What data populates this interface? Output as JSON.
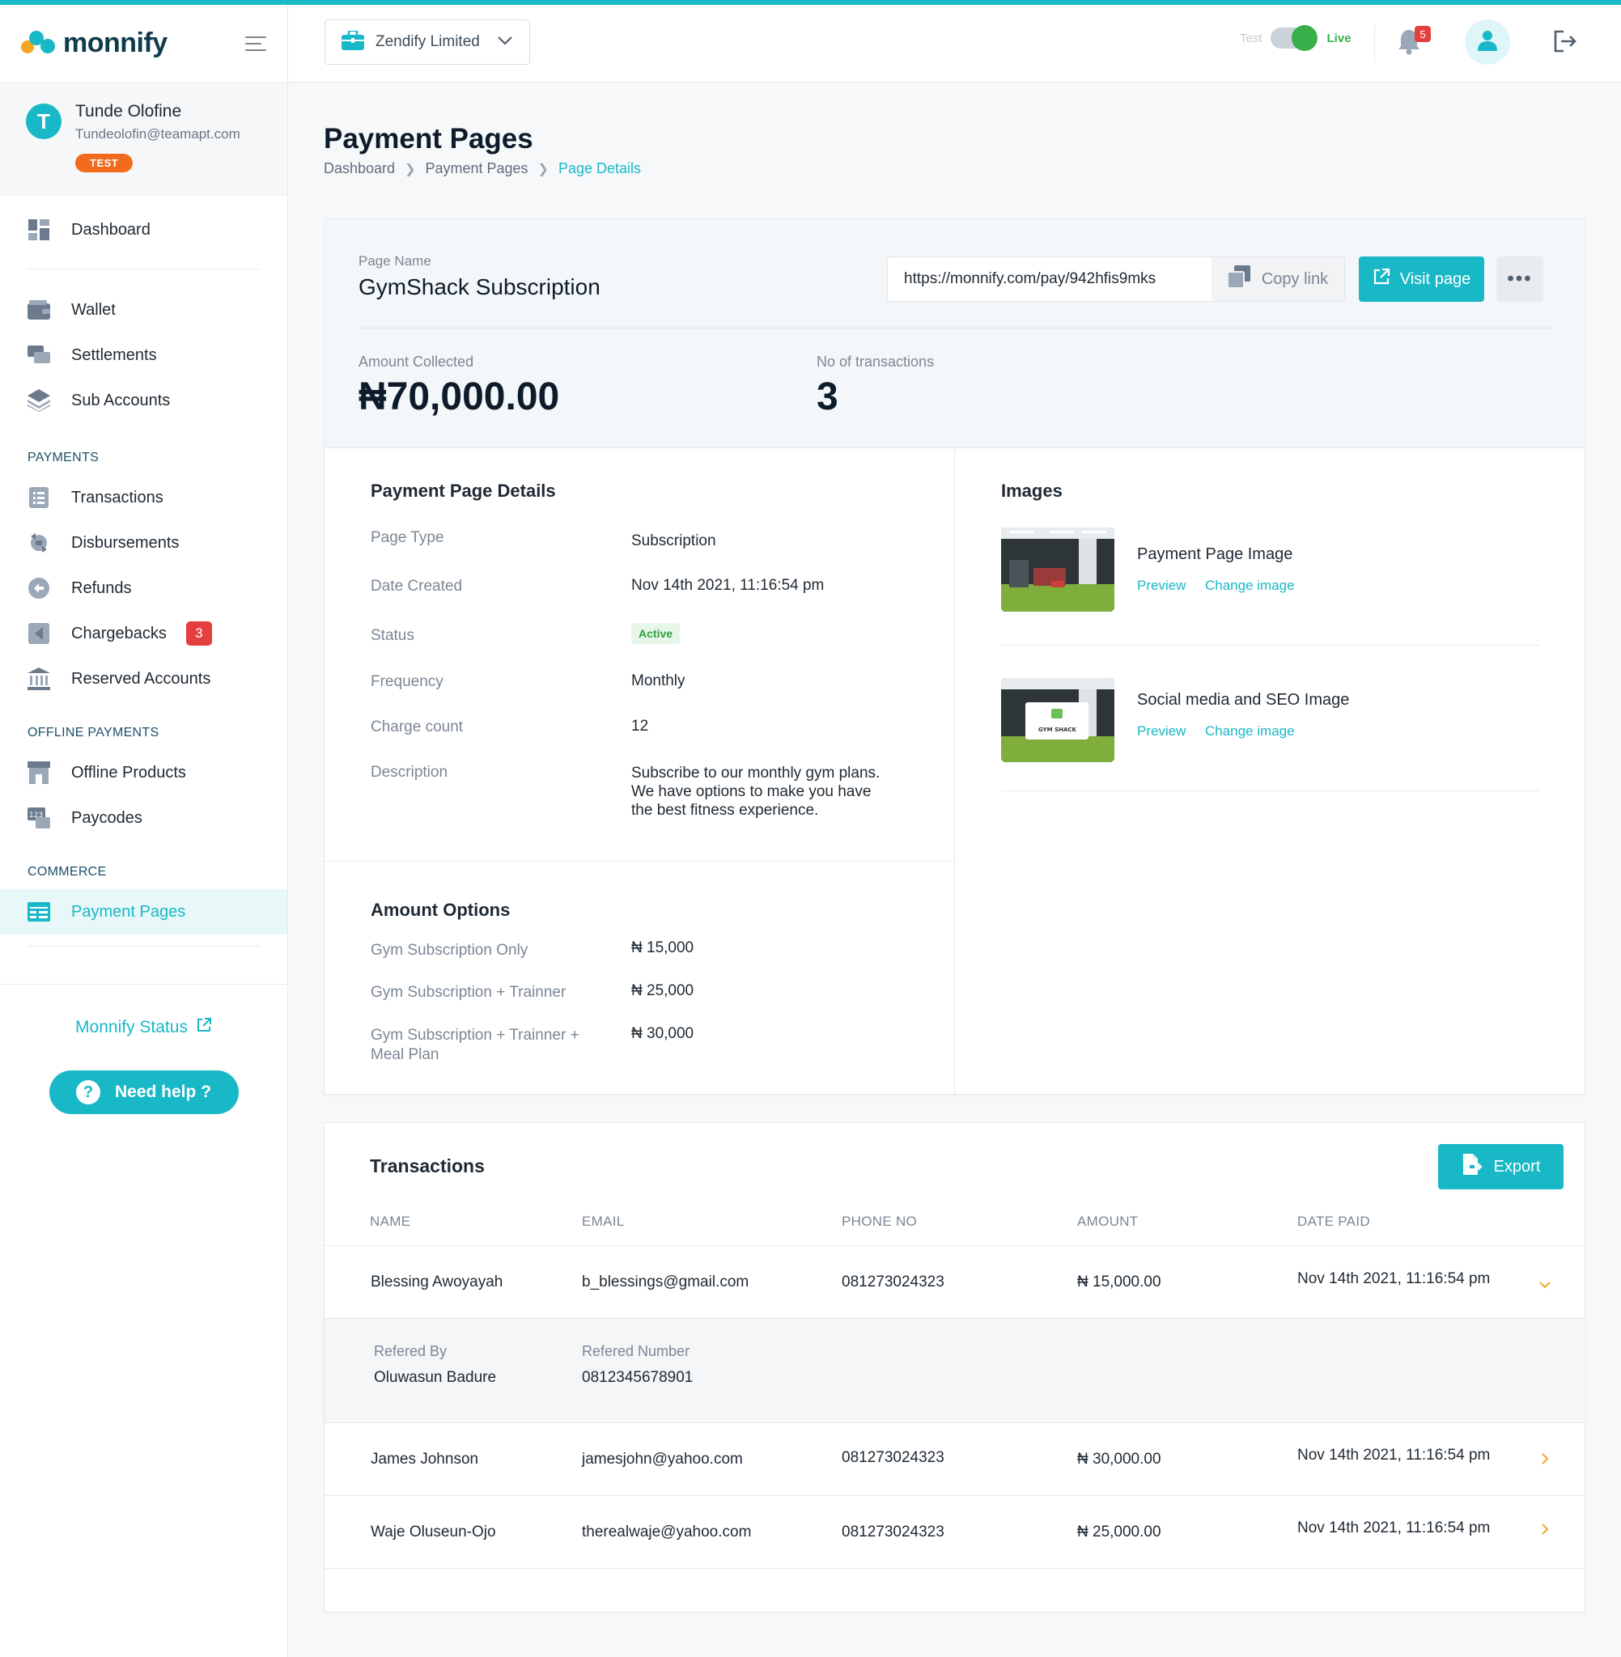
{
  "brand": {
    "name": "monnify",
    "accent": "#19b8c7"
  },
  "user": {
    "initial": "T",
    "name": "Tunde Olofine",
    "email": "Tundeolofin@teamapt.com",
    "env_badge": "TEST"
  },
  "nav": {
    "top": [
      {
        "label": "Dashboard",
        "icon": "dashboard-icon"
      }
    ],
    "main": [
      {
        "label": "Wallet",
        "icon": "wallet-icon"
      },
      {
        "label": "Settlements",
        "icon": "settlements-icon"
      },
      {
        "label": "Sub Accounts",
        "icon": "layers-icon"
      }
    ],
    "payments_heading": "PAYMENTS",
    "payments": [
      {
        "label": "Transactions",
        "icon": "list-icon"
      },
      {
        "label": "Disbursements",
        "icon": "disbursements-icon"
      },
      {
        "label": "Refunds",
        "icon": "refund-icon"
      },
      {
        "label": "Chargebacks",
        "icon": "chargeback-icon",
        "badge": "3"
      },
      {
        "label": "Reserved Accounts",
        "icon": "bank-icon"
      }
    ],
    "offline_heading": "OFFLINE PAYMENTS",
    "offline": [
      {
        "label": "Offline Products",
        "icon": "store-icon"
      },
      {
        "label": "Paycodes",
        "icon": "paycode-icon"
      }
    ],
    "commerce_heading": "COMMERCE",
    "commerce": [
      {
        "label": "Payment Pages",
        "icon": "payment-page-icon",
        "active": true
      }
    ],
    "status_link": "Monnify Status",
    "help_label": "Need help ?"
  },
  "header": {
    "business": "Zendify Limited",
    "mode_test": "Test",
    "mode_live": "Live",
    "notifications_count": "5"
  },
  "page": {
    "title": "Payment Pages",
    "breadcrumb": [
      "Dashboard",
      "Payment Pages",
      "Page Details"
    ]
  },
  "summary": {
    "page_name_label": "Page Name",
    "page_name": "GymShack Subscription",
    "url": "https://monnify.com/pay/942hfis9mks",
    "copy_label": "Copy link",
    "visit_label": "Visit page",
    "amount_label": "Amount Collected",
    "amount": "₦70,000.00",
    "tx_count_label": "No of transactions",
    "tx_count": "3"
  },
  "details": {
    "heading": "Payment Page Details",
    "page_type_label": "Page Type",
    "page_type": "Subscription",
    "date_label": "Date Created",
    "date": "Nov 14th 2021, 11:16:54 pm",
    "status_label": "Status",
    "status": "Active",
    "frequency_label": "Frequency",
    "frequency": "Monthly",
    "charge_label": "Charge count",
    "charge": "12",
    "desc_label": "Description",
    "desc_lines": [
      "Subscribe to our monthly gym plans.",
      "We have options to make you have",
      "the best fitness experience."
    ]
  },
  "amount_options": {
    "heading": "Amount Options",
    "items": [
      {
        "label_lines": [
          "Gym Subscription Only"
        ],
        "value": "₦ 15,000"
      },
      {
        "label_lines": [
          "Gym Subscription + Trainner"
        ],
        "value": "₦ 25,000"
      },
      {
        "label_lines": [
          "Gym Subscription + Trainner +",
          "Meal Plan"
        ],
        "value": "₦ 30,000"
      }
    ]
  },
  "images": {
    "heading": "Images",
    "items": [
      {
        "title": "Payment Page Image",
        "preview": "Preview",
        "change": "Change image"
      },
      {
        "title": "Social media and SEO Image",
        "preview": "Preview",
        "change": "Change image",
        "thumb_text": "GYM SHACK"
      }
    ]
  },
  "transactions": {
    "heading": "Transactions",
    "export_label": "Export",
    "columns": [
      "NAME",
      "EMAIL",
      "PHONE NO",
      "AMOUNT",
      "DATE PAID"
    ],
    "rows": [
      {
        "name": "Blessing Awoyayah",
        "email": "b_blessings@gmail.com",
        "phone": "081273024323",
        "amount": "₦ 15,000.00",
        "date": "Nov 14th 2021, 11:16:54 pm",
        "expanded": true
      },
      {
        "name": "James Johnson",
        "email": "jamesjohn@yahoo.com",
        "phone": "081273024323",
        "amount": "₦ 30,000.00",
        "date": "Nov 14th 2021, 11:16:54 pm"
      },
      {
        "name": "Waje Oluseun-Ojo",
        "email": "therealwaje@yahoo.com",
        "phone": "081273024323",
        "amount": "₦ 25,000.00",
        "date": "Nov 14th 2021, 11:16:54 pm"
      }
    ],
    "expanded_detail": {
      "ref_by_label": "Refered By",
      "ref_by": "Oluwasun Badure",
      "ref_num_label": "Refered Number",
      "ref_num": "0812345678901"
    }
  }
}
